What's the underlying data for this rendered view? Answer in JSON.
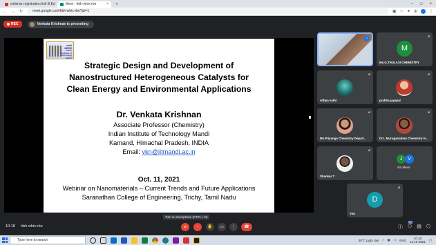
{
  "browser": {
    "tabs": [
      {
        "label": "webinar registration link B.Ed",
        "fav_color": "#d93025",
        "active": false
      },
      {
        "label": "Meet - hbh-whix-rbe",
        "fav_color": "#00897b",
        "active": true
      }
    ],
    "url": "meet.google.com/hbh-whix-rbe?pli=1"
  },
  "meeting": {
    "rec_label": "REC",
    "presenting_text": "Venkata Krishnan is presenting",
    "time": "10:18",
    "code": "hbh-whix-rbe",
    "tooltip": "Turn on microphone (CTRL + D)",
    "people_badge": "49"
  },
  "slide": {
    "logo_text": "भारतीय प्रौद्योगिकी संस्थान मंडी Indian Institute of Technology Mandi",
    "title_lines": [
      "Strategic Design and Development of",
      "Nanostructured Heterogeneous Catalysts for",
      "Clean Energy and Environmental Applications"
    ],
    "presenter": "Dr. Venkata Krishnan",
    "role": "Associate Professor (Chemistry)",
    "institute": "Indian Institute of Technology Mandi",
    "location": "Kamand, Himachal Pradesh, INDIA",
    "email_label": "Email: ",
    "email": "vkn@iitmandi.ac.in",
    "date": "Oct. 11, 2021",
    "event": "Webinar on Nanomaterials – Current Trends and Future Applications",
    "college": "Saranathan College of Engineering, Trichy, Tamil Nadu"
  },
  "participants": [
    {
      "name": "",
      "type": "photo",
      "color": "#b08a6e"
    },
    {
      "name": "Ms.G.THULASI CHEMISTRY",
      "type": "letter",
      "letter": "M",
      "color": "#1e8e3e"
    },
    {
      "name": "vithya eathi",
      "type": "photo",
      "color": "#1f8a8a"
    },
    {
      "name": "prabha jayapal",
      "type": "photo",
      "color": "#c0392b"
    },
    {
      "name": "Ms.Priyanga Chemistry Depart...",
      "type": "photo",
      "color": "#c77b6a"
    },
    {
      "name": "Dr.L.Muruganadam Chemistry H...",
      "type": "photo",
      "color": "#8c5a3c"
    },
    {
      "name": "Shankar T",
      "type": "photo",
      "color": "#6d5144"
    },
    {
      "name": "44 others",
      "type": "others",
      "letters": [
        "J",
        "V"
      ],
      "colors": [
        "#1e8e3e",
        "#1a73e8"
      ]
    },
    {
      "name": "You",
      "type": "letter",
      "letter": "D",
      "color": "#129eaf"
    }
  ],
  "taskbar": {
    "search_placeholder": "Type here to search",
    "weather": "30°C  Light rain",
    "lang": "ENG",
    "clock_time": "10:18",
    "clock_date": "11-10-2021"
  }
}
